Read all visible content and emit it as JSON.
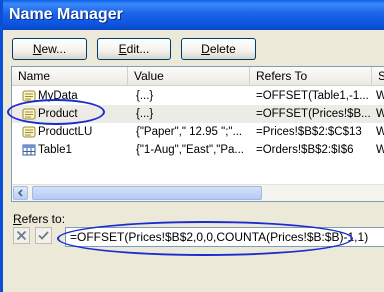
{
  "window": {
    "title": "Name Manager"
  },
  "toolbar": {
    "new_prefix": "",
    "new_accel": "N",
    "new_rest": "ew...",
    "edit_accel": "E",
    "edit_rest": "dit...",
    "delete_prefix": "",
    "delete_accel": "D",
    "delete_rest": "elete"
  },
  "columns": [
    "Name",
    "Value",
    "Refers To",
    "S"
  ],
  "rows": [
    {
      "name": "MyData",
      "value": "{...}",
      "refers_to": "=OFFSET(Table1,-1...",
      "scope": "W",
      "icon": "named-range-icon",
      "selected": false
    },
    {
      "name": "Product",
      "value": "{...}",
      "refers_to": "=OFFSET(Prices!$B...",
      "scope": "W",
      "icon": "named-range-icon",
      "selected": true
    },
    {
      "name": "ProductLU",
      "value": "{\"Paper\",\" 12.95 \";\"...",
      "refers_to": "=Prices!$B$2:$C$13",
      "scope": "W",
      "icon": "named-range-icon",
      "selected": false
    },
    {
      "name": "Table1",
      "value": "{\"1-Aug\",\"East\",\"Pa...",
      "refers_to": "=Orders!$B$2:$I$6",
      "scope": "W",
      "icon": "table-icon",
      "selected": false
    }
  ],
  "refers": {
    "label_accel": "R",
    "label_rest": "efers to:",
    "value": "=OFFSET(Prices!$B$2,0,0,COUNTA(Prices!$B:$B)-1,1)"
  },
  "colors": {
    "title_bar": "#0a5ee8",
    "annotation": "#1a2bd0",
    "dialog_bg": "#ece9d8"
  }
}
